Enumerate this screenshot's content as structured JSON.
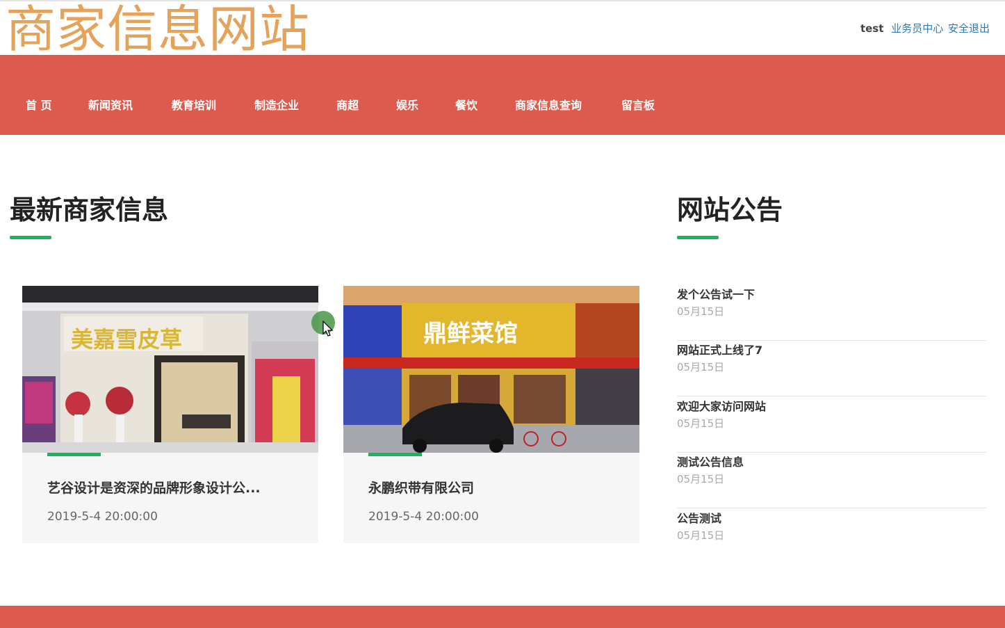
{
  "header": {
    "site_title": "商家信息网站",
    "username": "test",
    "user_center_label": "业务员中心",
    "logout_label": "安全退出"
  },
  "nav": {
    "items": [
      "首 页",
      "新闻资讯",
      "教育培训",
      "制造企业",
      "商超",
      "娱乐",
      "餐饮",
      "商家信息查询",
      "留言板"
    ]
  },
  "merchants": {
    "title": "最新商家信息",
    "cards": [
      {
        "title": "艺谷设计是资深的品牌形象设计公...",
        "date": "2019-5-4 20:00:00",
        "sign_text": "美嘉雪皮草"
      },
      {
        "title": "永鹏织带有限公司",
        "date": "2019-5-4 20:00:00",
        "sign_text": "鼎鲜菜馆"
      }
    ]
  },
  "notices": {
    "title": "网站公告",
    "items": [
      {
        "title": "发个公告试一下",
        "date": "05月15日"
      },
      {
        "title": "网站正式上线了7",
        "date": "05月15日"
      },
      {
        "title": "欢迎大家访问网站",
        "date": "05月15日"
      },
      {
        "title": "测试公告信息",
        "date": "05月15日"
      },
      {
        "title": "公告测试",
        "date": "05月15日"
      }
    ]
  },
  "colors": {
    "nav_bg": "#dd5a4e",
    "accent_green": "#1db35a",
    "title_orange": "#e5a25a",
    "link_blue": "#2b7bb9"
  }
}
